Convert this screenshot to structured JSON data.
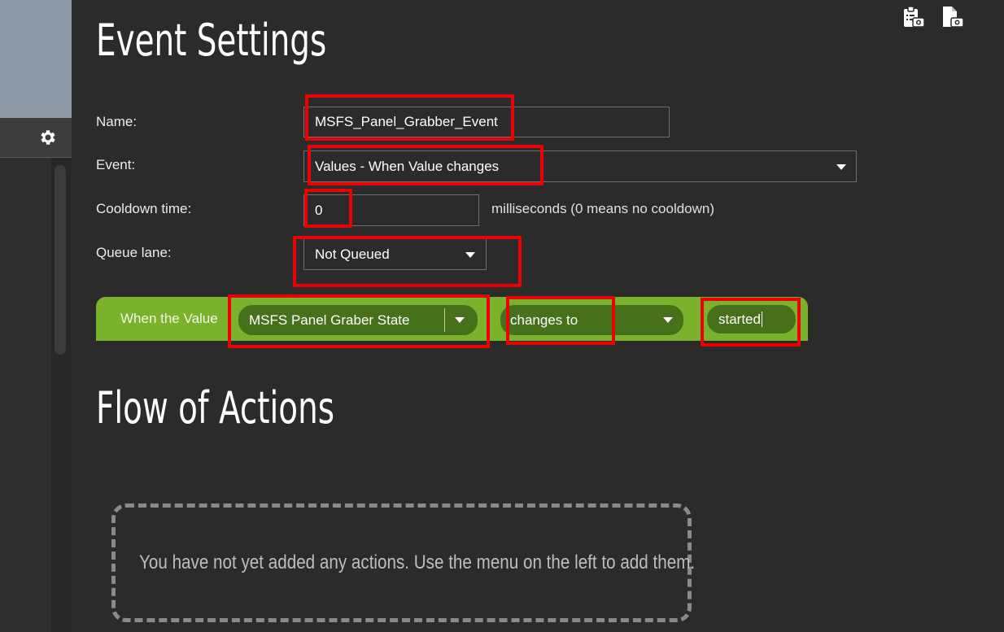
{
  "page": {
    "title": "Event Settings",
    "flow_title": "Flow of Actions"
  },
  "sidebar": {
    "settings_icon": "gear-icon"
  },
  "toolbar": {
    "icons": [
      "clipboard-camera-icon",
      "file-camera-icon"
    ]
  },
  "form": {
    "name_label": "Name:",
    "name_value": "MSFS_Panel_Grabber_Event",
    "event_label": "Event:",
    "event_value": "Values - When Value changes",
    "cooldown_label": "Cooldown time:",
    "cooldown_value": "0",
    "cooldown_note": "milliseconds (0 means no cooldown)",
    "queue_label": "Queue lane:",
    "queue_value": "Not Queued"
  },
  "condition": {
    "prefix": "When the Value",
    "value_name": "MSFS Panel Graber State",
    "operator": "changes to",
    "compare_value": "started",
    "accent_color": "#7ab22c",
    "pill_color": "#47701a"
  },
  "actions": {
    "empty_message": "You have not yet added any actions. Use the menu on the left to add them."
  },
  "highlight_color": "#ee0000"
}
